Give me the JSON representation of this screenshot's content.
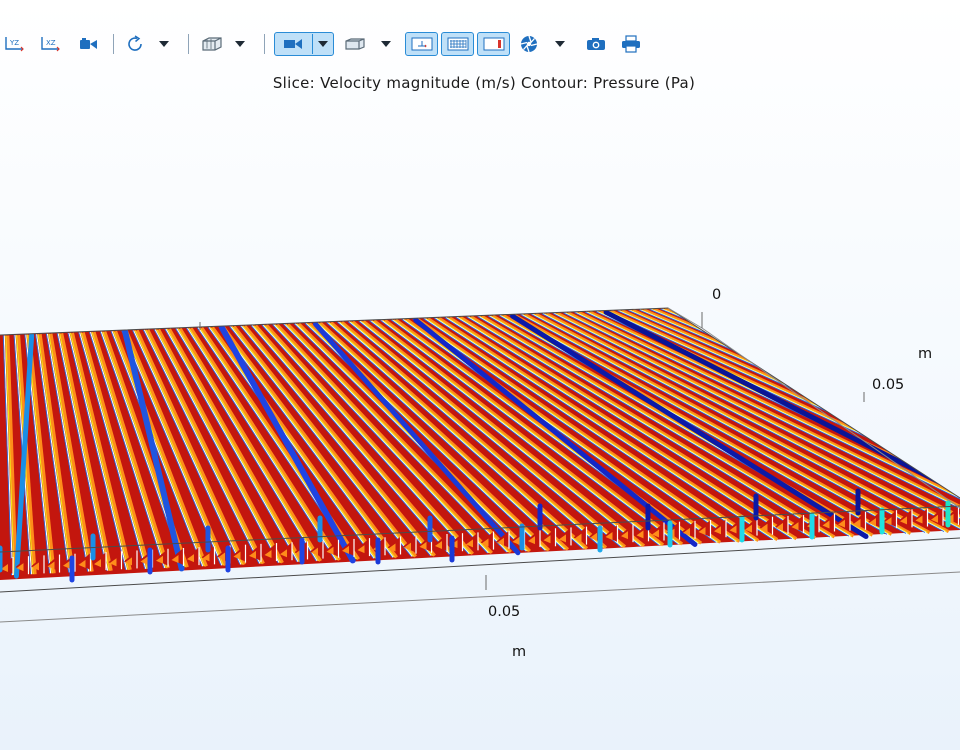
{
  "toolbar": {
    "items": [
      {
        "name": "view-yz-button",
        "icon": "view-yz-icon",
        "label": "YZ"
      },
      {
        "name": "view-xz-button",
        "icon": "view-xz-icon",
        "label": "XZ"
      },
      {
        "name": "camera-view-button",
        "icon": "camera-view-icon"
      },
      {
        "name": "reset-view-button",
        "icon": "rotate-icon"
      },
      {
        "name": "transparency-button",
        "icon": "box-wireframe-icon"
      },
      {
        "name": "scene-light-button",
        "icon": "scene-light-icon"
      },
      {
        "name": "render-mode-button",
        "icon": "render-mode-icon"
      },
      {
        "name": "show-axis-button",
        "icon": "axis-orientation-icon"
      },
      {
        "name": "show-grid-button",
        "icon": "grid-icon"
      },
      {
        "name": "show-legends-button",
        "icon": "legend-icon"
      },
      {
        "name": "color-settings-button",
        "icon": "aperture-icon"
      },
      {
        "name": "image-snapshot-button",
        "icon": "camera-icon"
      },
      {
        "name": "print-button",
        "icon": "printer-icon"
      }
    ],
    "colors": {
      "active_bg": "#bfe0f8",
      "active_border": "#2a8cd6",
      "icon_blue": "#1f6fbf"
    }
  },
  "plot": {
    "title": "Slice: Velocity magnitude (m/s)  Contour: Pressure (Pa)",
    "axis_y": {
      "tick_0": "0",
      "tick_1": "0.05",
      "unit": "m"
    },
    "axis_x": {
      "tick_1": "0.05",
      "unit": "m"
    },
    "colors": {
      "red": "#c3160e",
      "orange": "#ff8c1a",
      "yellow": "#f3e21a",
      "blue": "#1e3ad8",
      "cyan": "#1fd9ea",
      "frame": "#4b4b4b"
    }
  }
}
